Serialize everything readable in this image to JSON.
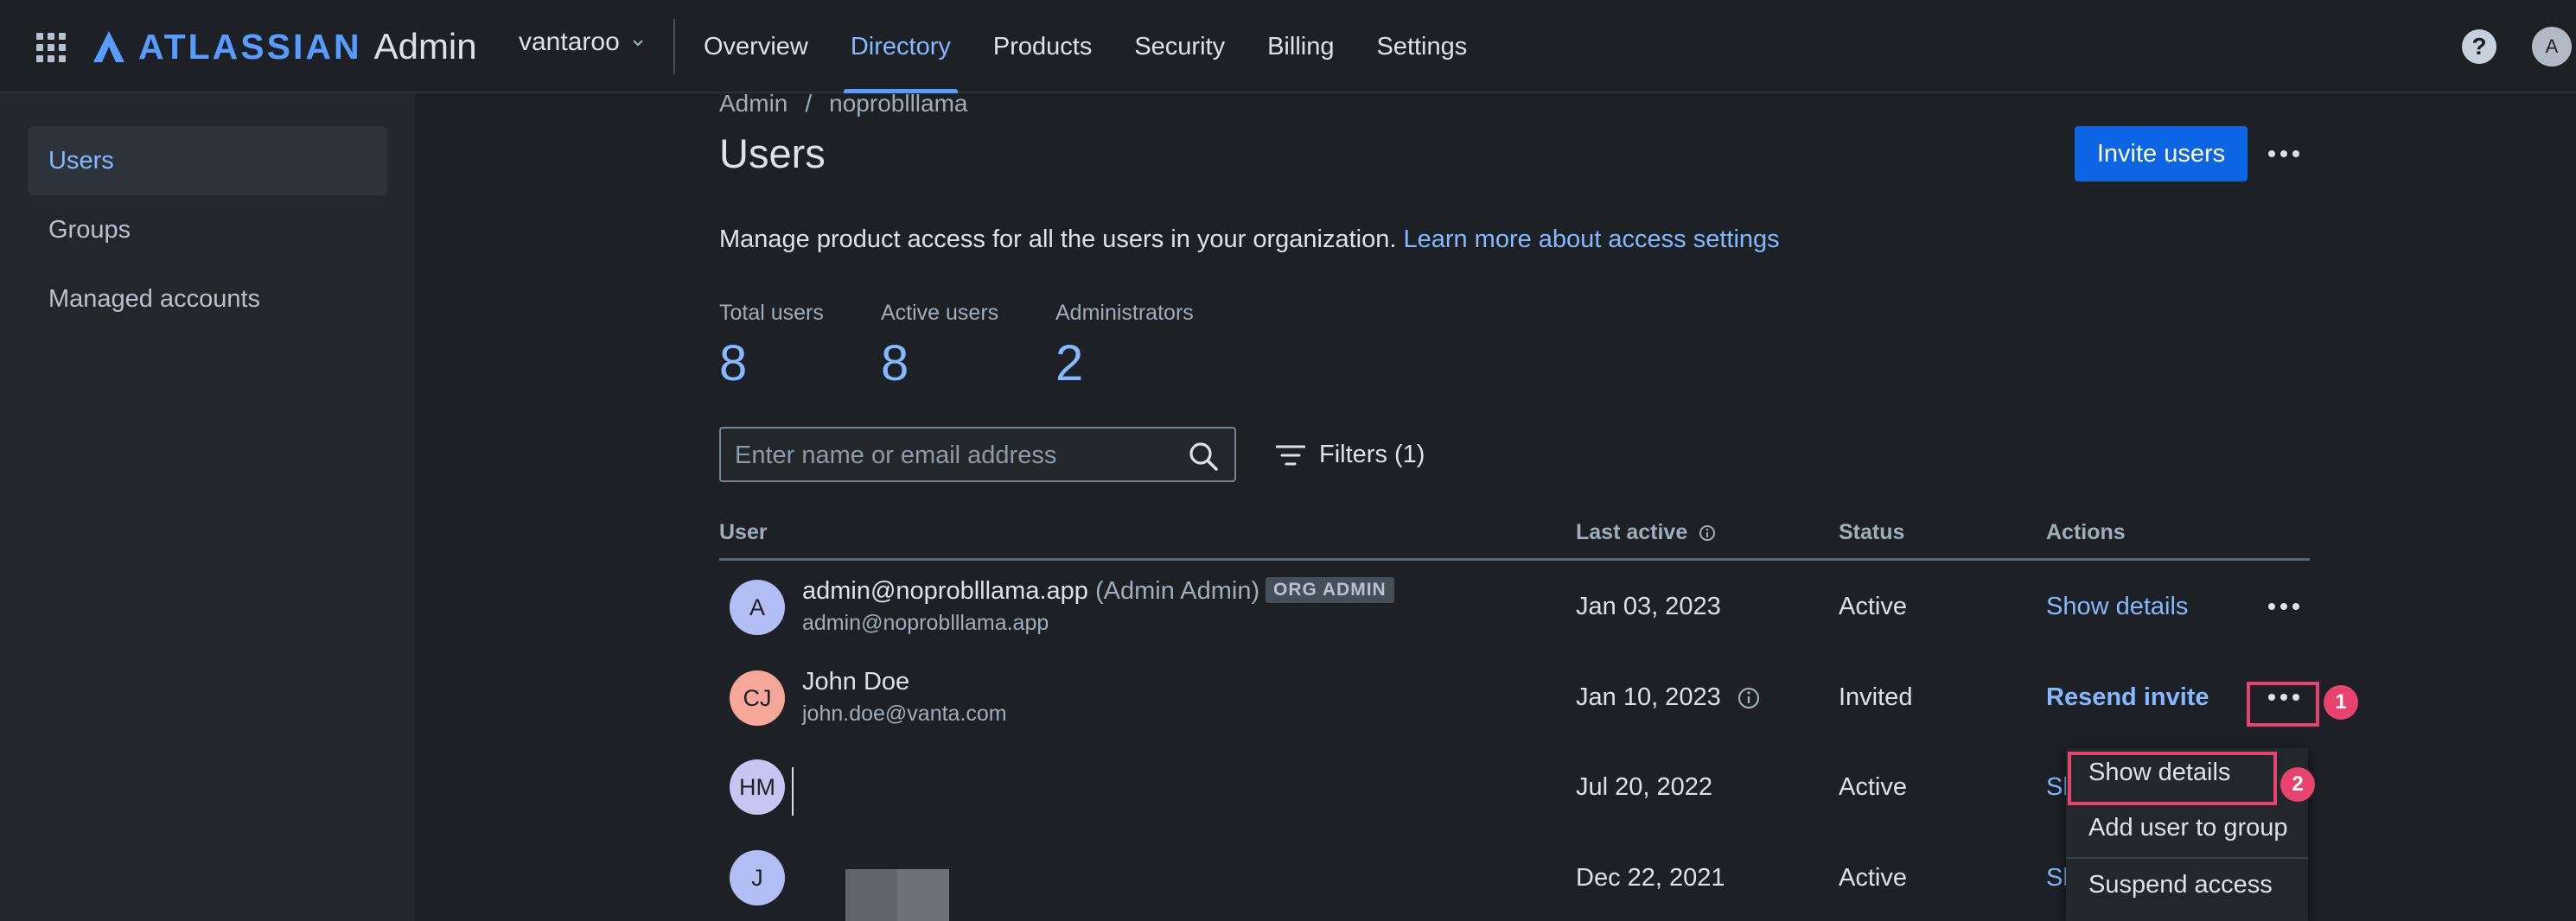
{
  "header": {
    "brand": "ATLASSIAN",
    "product": "Admin",
    "org": "vantaroo",
    "tabs": [
      "Overview",
      "Directory",
      "Products",
      "Security",
      "Billing",
      "Settings"
    ],
    "active_tab": "Directory",
    "help": "?",
    "avatar": "A"
  },
  "sidebar": {
    "items": [
      "Users",
      "Groups",
      "Managed accounts"
    ],
    "active": "Users"
  },
  "breadcrumb": {
    "root": "Admin",
    "separator": "/",
    "current": "noproblllama"
  },
  "page": {
    "title": "Users",
    "invite_label": "Invite users",
    "description": "Manage product access for all the users in your organization.",
    "learn_more": "Learn more about access settings"
  },
  "stats": [
    {
      "label": "Total users",
      "value": "8"
    },
    {
      "label": "Active users",
      "value": "8"
    },
    {
      "label": "Administrators",
      "value": "2"
    }
  ],
  "search": {
    "placeholder": "Enter name or email address",
    "value": ""
  },
  "filters": {
    "label": "Filters (1)"
  },
  "table": {
    "columns": [
      "User",
      "Last active",
      "Status",
      "Actions"
    ],
    "rows": [
      {
        "avatar": "A",
        "avatar_color": "#b3bef5",
        "name": "admin@noproblllama.app",
        "alias": "(Admin Admin)",
        "badge": "ORG ADMIN",
        "email": "admin@noproblllama.app",
        "last_active": "Jan 03, 2023",
        "status": "Active",
        "action": "Show details"
      },
      {
        "avatar": "CJ",
        "avatar_color": "#f5a89a",
        "name": "John Doe",
        "email": "john.doe@vanta.com",
        "last_active": "Jan 10, 2023",
        "status": "Invited",
        "action": "Resend invite"
      },
      {
        "avatar": "HM",
        "avatar_color": "#c9c4f2",
        "last_active": "Jul 20, 2022",
        "status": "Active",
        "action": "Sh"
      },
      {
        "avatar": "J",
        "avatar_color": "#b3bef5",
        "last_active": "Dec 22, 2021",
        "status": "Active",
        "action": "Sh"
      }
    ]
  },
  "row_menu": {
    "items": [
      "Show details",
      "Add user to group",
      "Suspend access"
    ]
  },
  "annotations": {
    "step1": "1",
    "step2": "2",
    "color": "#e8426e"
  },
  "colors": {
    "accent": "#85b8ff",
    "primary_button": "#0c66e4",
    "background": "#1d2125"
  }
}
